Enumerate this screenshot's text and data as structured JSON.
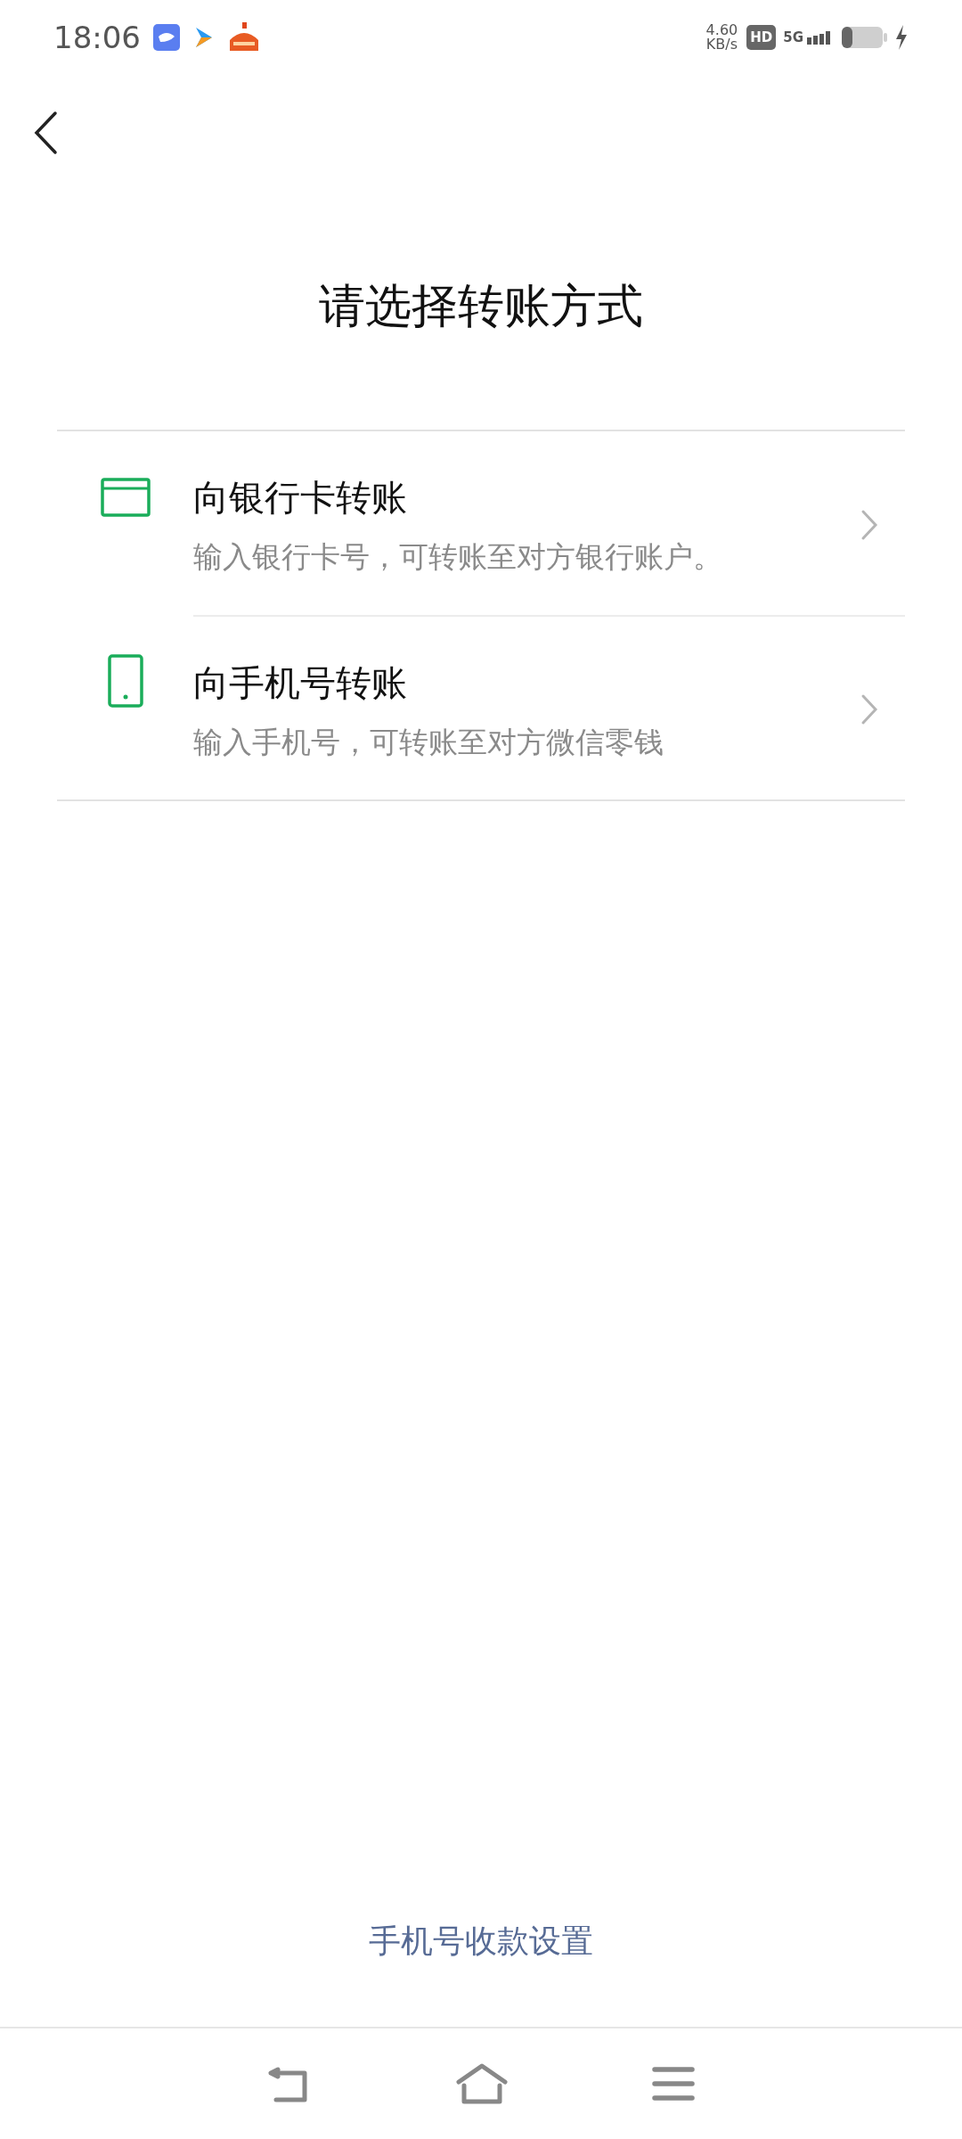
{
  "status_bar": {
    "time": "18:06",
    "speed_value": "4.60",
    "speed_unit": "KB/s",
    "hd": "HD",
    "network": "5G"
  },
  "title": "请选择转账方式",
  "options": [
    {
      "kind": "bank_card",
      "title": "向银行卡转账",
      "subtitle": "输入银行卡号，可转账至对方银行账户。"
    },
    {
      "kind": "phone",
      "title": "向手机号转账",
      "subtitle": "输入手机号，可转账至对方微信零钱"
    }
  ],
  "footer_link": "手机号收款设置"
}
